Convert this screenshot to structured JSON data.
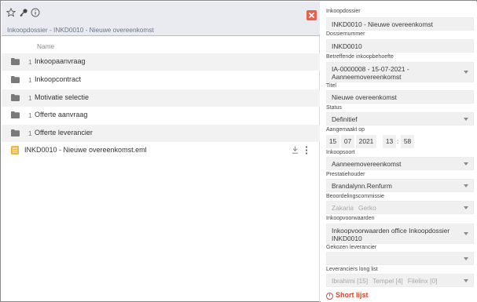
{
  "left": {
    "breadcrumb": "Inkoopdossier - INKD0010 - Nieuwe overeenkomst",
    "column_header": "Name",
    "folders": [
      {
        "count": "1",
        "label": "Inkoopaanvraag"
      },
      {
        "count": "1",
        "label": "Inkoopcontract"
      },
      {
        "count": "1",
        "label": "Motivatie selectie"
      },
      {
        "count": "1",
        "label": "Offerte aanvraag"
      },
      {
        "count": "1",
        "label": "Offerte leverancier"
      }
    ],
    "file": {
      "label": "INKD0010 - Nieuwe overeenkomst.eml"
    }
  },
  "form": {
    "inkoopdossier": {
      "label": "Inkoopdossier",
      "value": "INKD0010 - Nieuwe overeenkomst"
    },
    "dossiernummer": {
      "label": "Dossiernummer",
      "value": "INKD0010"
    },
    "behoefte": {
      "label": "Betreffende inkoopbehoefte",
      "value_line1": "IA-0000008 - 15-07-2021 -",
      "value_line2": "Aanneemovereenkomst"
    },
    "titel": {
      "label": "Titel",
      "value": "Nieuwe overeenkomst"
    },
    "status": {
      "label": "Status",
      "value": "Definitief"
    },
    "aangemaakt": {
      "label": "Aangemaakt op",
      "day": "15",
      "month": "07",
      "year": "2021",
      "hour": "13",
      "minute": "58",
      "sep": ":"
    },
    "inkoopsoort": {
      "label": "Inkoopsoort",
      "value": "Aanneemovereenkomst"
    },
    "prestatiehouder": {
      "label": "Prestatiehouder",
      "value": "Brandalynn.Renfurm"
    },
    "commissie": {
      "label": "Beoordelingscommissie",
      "tags": [
        "Zakaria",
        "Gerko"
      ]
    },
    "voorwaarden": {
      "label": "Inkoopvoorwaarden",
      "value_line1": "Inkoopvoorwaarden office Inkoopdossier",
      "value_line2": "INKD0010"
    },
    "gekozen": {
      "label": "Gekozen leverancier",
      "value": ""
    },
    "longlist": {
      "label": "Leveranciers long list",
      "tags": [
        "Ibrahimi [15]",
        "Tempel [4]",
        "Filelinx [0]"
      ]
    },
    "shortlist": {
      "label": "Short lijst",
      "icon": "info-circle-icon"
    }
  },
  "colors": {
    "accent_red": "#e8614a",
    "folder": "#7a7a7a",
    "file_icon": "#e6b94a",
    "header_bg": "#e9ebf0"
  }
}
